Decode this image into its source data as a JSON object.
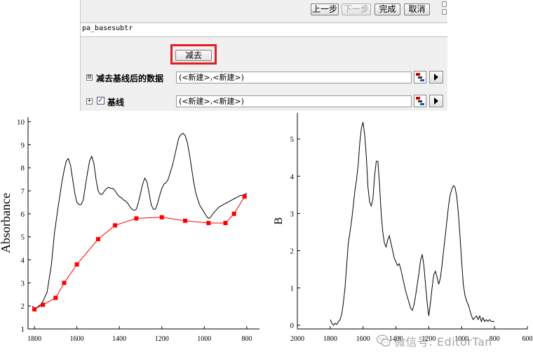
{
  "dialog": {
    "buttons": {
      "prev": "上一步",
      "next": "下一步",
      "finish": "完成",
      "cancel": "取消"
    },
    "function_name": "pa_basesubtr",
    "subtract_button": "减去",
    "rows": [
      {
        "label": "减去基线后的数据",
        "value": "(<新建>,<新建>)",
        "checked": null
      },
      {
        "label": "基线",
        "value": "(<新建>,<新建>)",
        "checked": true
      }
    ]
  },
  "chart_data": [
    {
      "type": "line",
      "ylabel": "Absorbance",
      "xlabel": "",
      "xlim": [
        1830,
        740
      ],
      "ylim": [
        1,
        10.2
      ],
      "x_ticks": [
        "1800",
        "1600",
        "1400",
        "1200",
        "1000",
        "800"
      ],
      "y_ticks": [
        "1",
        "2",
        "3",
        "4",
        "5",
        "6",
        "7",
        "8",
        "9",
        "10"
      ],
      "series": [
        {
          "color": "#000000",
          "x": [
            1810,
            1795,
            1780,
            1770,
            1760,
            1740,
            1720,
            1705,
            1690,
            1680,
            1670,
            1660,
            1650,
            1640,
            1630,
            1620,
            1610,
            1600,
            1590,
            1580,
            1570,
            1560,
            1550,
            1540,
            1530,
            1520,
            1510,
            1500,
            1490,
            1480,
            1470,
            1460,
            1450,
            1440,
            1430,
            1420,
            1410,
            1400,
            1390,
            1380,
            1370,
            1360,
            1350,
            1340,
            1330,
            1320,
            1310,
            1300,
            1290,
            1280,
            1270,
            1260,
            1250,
            1240,
            1230,
            1220,
            1210,
            1200,
            1190,
            1180,
            1170,
            1160,
            1150,
            1140,
            1130,
            1120,
            1110,
            1100,
            1090,
            1080,
            1070,
            1060,
            1050,
            1040,
            1030,
            1020,
            1010,
            1000,
            990,
            980,
            970,
            960,
            950,
            940,
            930,
            920,
            910,
            900,
            890,
            880,
            870,
            860,
            850,
            840,
            830,
            820,
            810,
            800
          ],
          "values": [
            2.0,
            1.85,
            2.0,
            2.05,
            2.2,
            2.6,
            3.8,
            5.2,
            6.2,
            6.8,
            7.4,
            7.9,
            8.3,
            8.4,
            8.1,
            7.5,
            6.9,
            6.5,
            6.4,
            6.4,
            6.6,
            7.2,
            7.8,
            8.3,
            8.5,
            8.2,
            7.5,
            7.0,
            6.85,
            6.85,
            7.0,
            7.1,
            7.15,
            7.1,
            7.1,
            7.0,
            6.85,
            6.75,
            6.7,
            6.6,
            6.55,
            6.45,
            6.3,
            6.2,
            6.15,
            6.2,
            6.5,
            6.9,
            7.3,
            7.55,
            7.4,
            6.9,
            6.4,
            6.2,
            6.2,
            6.45,
            6.8,
            7.1,
            7.3,
            7.35,
            7.5,
            7.8,
            8.1,
            8.5,
            8.9,
            9.3,
            9.45,
            9.5,
            9.4,
            9.1,
            8.6,
            8.0,
            7.4,
            6.9,
            6.6,
            6.35,
            6.2,
            6.05,
            5.9,
            5.8,
            5.85,
            6.0,
            6.1,
            6.2,
            6.3,
            6.35,
            6.4,
            6.45,
            6.5,
            6.55,
            6.6,
            6.65,
            6.7,
            6.75,
            6.8,
            6.8,
            6.85,
            6.9
          ]
        },
        {
          "color": "#ff0000",
          "marker_color": "#ff0000",
          "x": [
            1800,
            1760,
            1700,
            1660,
            1600,
            1500,
            1420,
            1320,
            1200,
            1090,
            980,
            900,
            860,
            810
          ],
          "values": [
            1.85,
            2.05,
            2.35,
            3.0,
            3.8,
            4.9,
            5.5,
            5.8,
            5.85,
            5.7,
            5.6,
            5.6,
            6.0,
            6.75
          ]
        }
      ]
    },
    {
      "type": "line",
      "ylabel": "B",
      "xlabel": "",
      "xlim": [
        2000,
        600
      ],
      "ylim": [
        -0.1,
        5.7
      ],
      "x_ticks": [
        "2000",
        "1800",
        "1600",
        "1400",
        "1200",
        "1000",
        "800",
        "600"
      ],
      "y_ticks": [
        "0",
        "1",
        "2",
        "3",
        "4",
        "5"
      ],
      "series": [
        {
          "color": "#000000",
          "x": [
            1800,
            1790,
            1780,
            1770,
            1760,
            1750,
            1740,
            1730,
            1720,
            1710,
            1700,
            1690,
            1680,
            1670,
            1660,
            1650,
            1640,
            1630,
            1620,
            1610,
            1600,
            1590,
            1580,
            1570,
            1560,
            1550,
            1540,
            1530,
            1520,
            1510,
            1500,
            1490,
            1480,
            1470,
            1460,
            1450,
            1440,
            1430,
            1420,
            1410,
            1400,
            1390,
            1380,
            1370,
            1360,
            1350,
            1340,
            1330,
            1320,
            1310,
            1300,
            1290,
            1280,
            1270,
            1260,
            1250,
            1240,
            1230,
            1220,
            1210,
            1200,
            1190,
            1180,
            1170,
            1160,
            1150,
            1140,
            1130,
            1120,
            1110,
            1100,
            1090,
            1080,
            1070,
            1060,
            1050,
            1040,
            1030,
            1020,
            1010,
            1000,
            990,
            980,
            970,
            960,
            950,
            940,
            930,
            920,
            910,
            900,
            890,
            880,
            870,
            860,
            850,
            840,
            830,
            820,
            810,
            800
          ],
          "values": [
            0.15,
            0.05,
            0.0,
            0.05,
            0.02,
            0.1,
            0.15,
            0.3,
            0.6,
            1.0,
            1.6,
            2.2,
            2.5,
            2.8,
            3.2,
            3.6,
            3.9,
            4.3,
            4.9,
            5.3,
            5.45,
            5.1,
            4.5,
            3.7,
            3.3,
            3.2,
            3.4,
            4.0,
            4.4,
            4.4,
            3.8,
            3.0,
            2.5,
            2.2,
            2.1,
            2.3,
            2.4,
            2.2,
            2.0,
            1.8,
            1.7,
            1.6,
            1.65,
            1.5,
            1.3,
            1.1,
            0.9,
            0.75,
            0.6,
            0.45,
            0.4,
            0.55,
            0.8,
            1.1,
            1.4,
            1.75,
            1.9,
            1.6,
            1.1,
            0.6,
            0.25,
            0.6,
            1.0,
            1.35,
            1.45,
            1.3,
            1.1,
            1.25,
            1.6,
            2.0,
            2.4,
            2.8,
            3.2,
            3.5,
            3.65,
            3.75,
            3.7,
            3.45,
            3.0,
            2.4,
            1.7,
            1.1,
            0.8,
            0.65,
            0.55,
            0.4,
            0.25,
            0.15,
            0.2,
            0.25,
            0.15,
            0.25,
            0.1,
            0.2,
            0.1,
            0.15,
            0.1,
            0.15,
            0.1,
            0.1,
            0.1
          ]
        }
      ]
    }
  ],
  "watermark": {
    "text": "微信号: EditorTan"
  }
}
